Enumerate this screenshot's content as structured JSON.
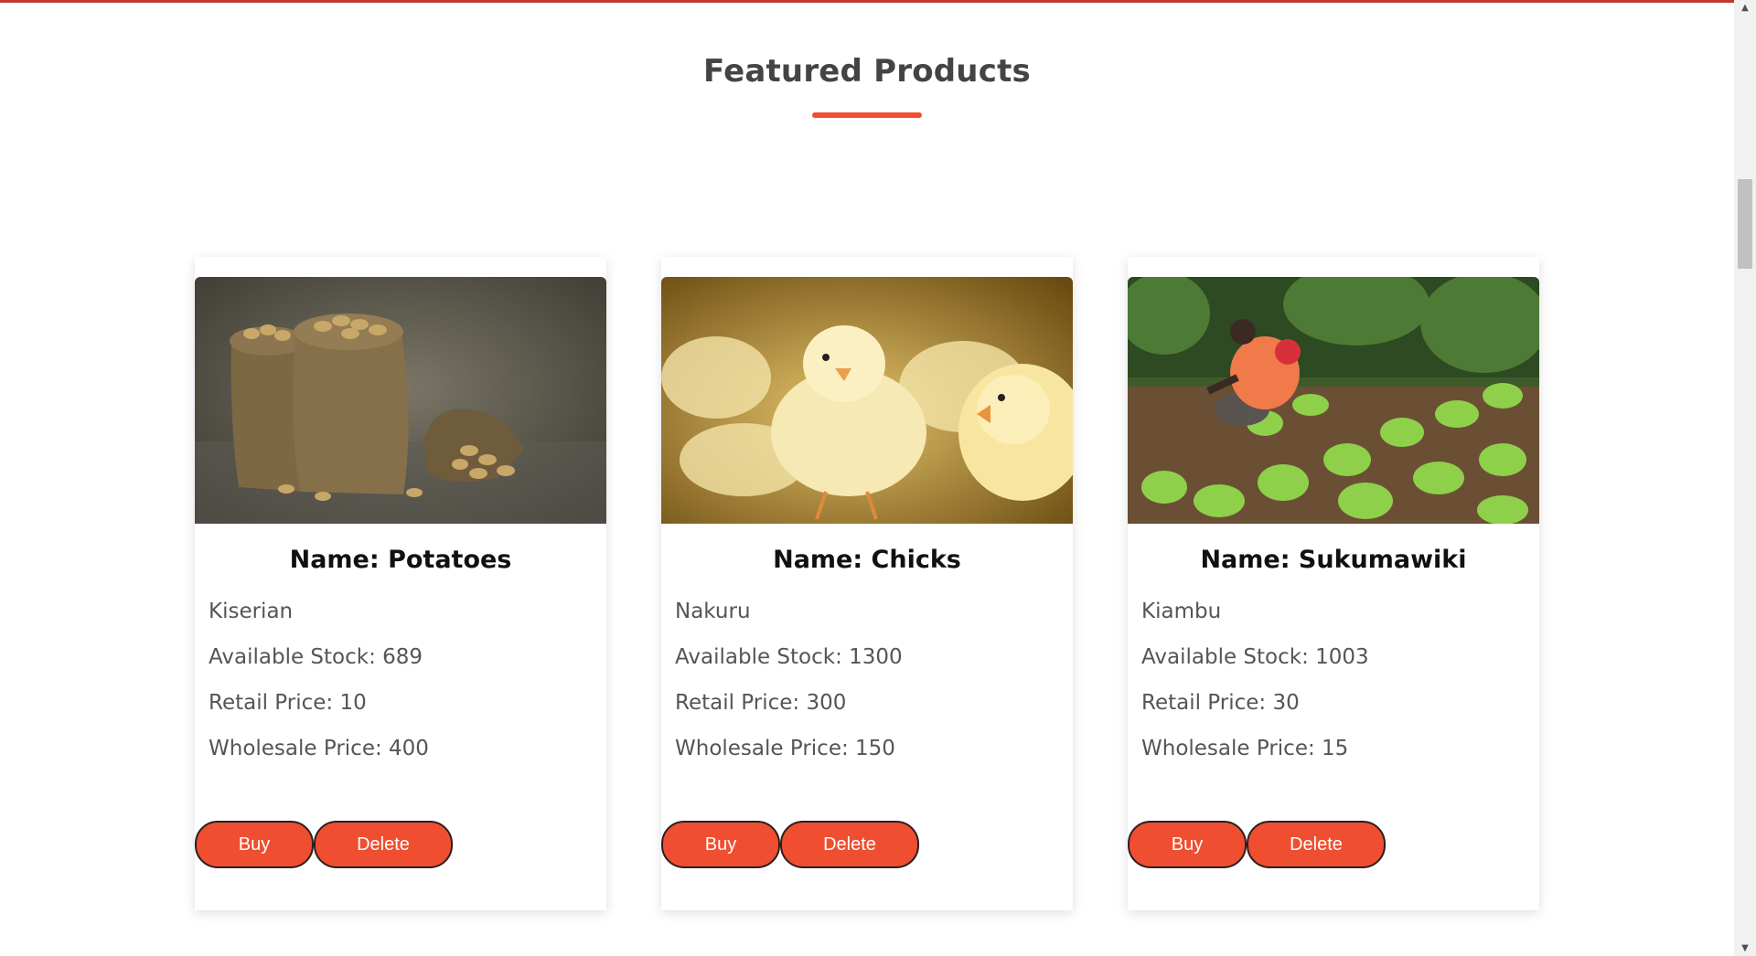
{
  "section": {
    "title": "Featured Products"
  },
  "colors": {
    "accent": "#f04e30",
    "top_border": "#c0392b"
  },
  "products": [
    {
      "name": "Name: Potatoes",
      "location": "Kiserian",
      "stock": "Available Stock: 689",
      "retail": "Retail Price: 10",
      "wholesale": "Wholesale Price: 400",
      "buy_label": "Buy",
      "delete_label": "Delete"
    },
    {
      "name": "Name: Chicks",
      "location": "Nakuru",
      "stock": "Available Stock: 1300",
      "retail": "Retail Price: 300",
      "wholesale": "Wholesale Price: 150",
      "buy_label": "Buy",
      "delete_label": "Delete"
    },
    {
      "name": "Name: Sukumawiki",
      "location": "Kiambu",
      "stock": "Available Stock: 1003",
      "retail": "Retail Price: 30",
      "wholesale": "Wholesale Price: 15",
      "buy_label": "Buy",
      "delete_label": "Delete"
    }
  ],
  "scrollbar": {
    "up_icon": "chevron-up-icon",
    "down_icon": "chevron-down-icon"
  }
}
